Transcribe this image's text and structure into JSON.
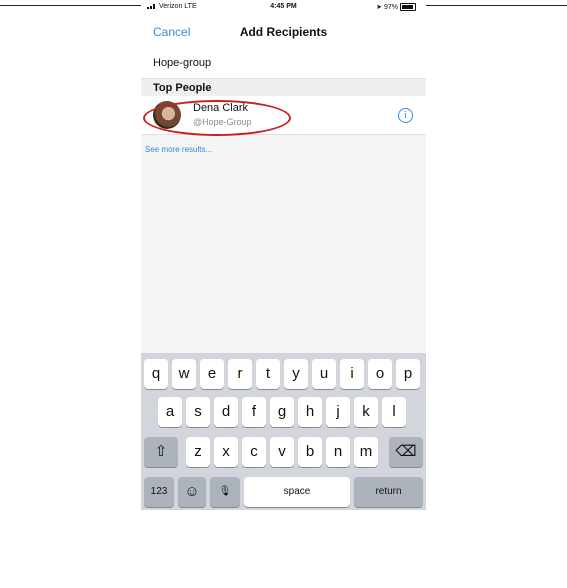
{
  "status_bar": {
    "carrier": "Verizon  LTE",
    "time": "4:45 PM",
    "battery": "97%"
  },
  "nav": {
    "cancel": "Cancel",
    "title": "Add Recipients"
  },
  "search": {
    "value": "Hope-group"
  },
  "section": {
    "title": "Top People"
  },
  "person": {
    "name": "Dena Clark",
    "handle": "@Hope-Group",
    "info_glyph": "i"
  },
  "see_more": "See more results...",
  "keyboard": {
    "row1": [
      "q",
      "w",
      "e",
      "r",
      "t",
      "y",
      "u",
      "i",
      "o",
      "p"
    ],
    "row2": [
      "a",
      "s",
      "d",
      "f",
      "g",
      "h",
      "j",
      "k",
      "l"
    ],
    "row3": [
      "z",
      "x",
      "c",
      "v",
      "b",
      "n",
      "m"
    ],
    "shift_glyph": "⇧",
    "delete_glyph": "⌫",
    "numbers": "123",
    "emoji_glyph": "☺",
    "mic_glyph": "🎙",
    "space": "space",
    "return": "return"
  },
  "colors": {
    "accent": "#3a8ad8",
    "highlight_circle": "#c8201f"
  }
}
